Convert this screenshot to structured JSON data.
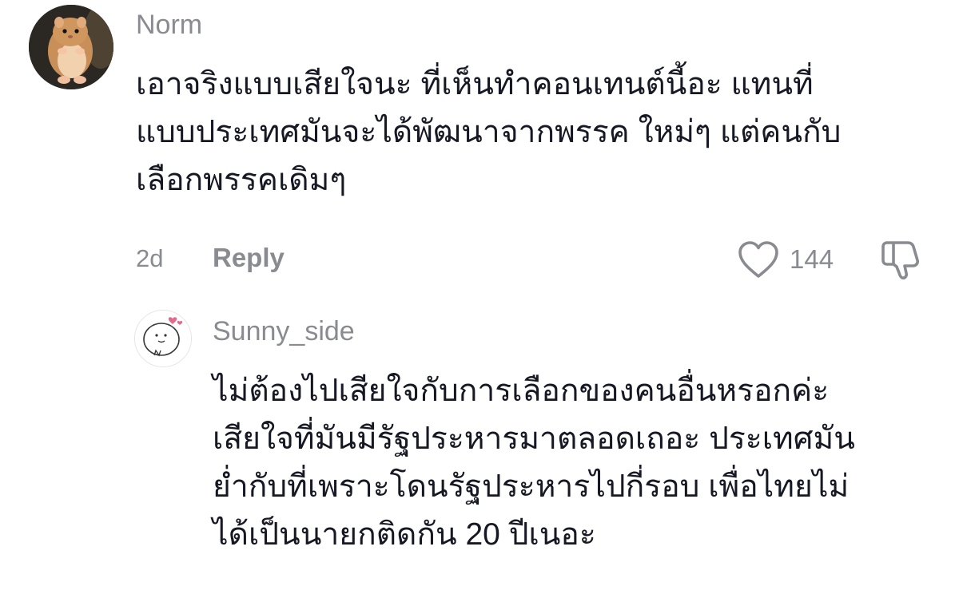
{
  "comments": [
    {
      "username": "Norm",
      "text_lines": [
        "เอาจริงแบบเสียใจนะ ที่เห็นทำคอนเทนต์นี้อะ แทนที่",
        "แบบประเทศมันจะได้พัฒนาจากพรรค ใหม่ๆ แต่คนกับ",
        "เลือกพรรคเดิมๆ"
      ],
      "age": "2d",
      "reply_label": "Reply",
      "like_count": "144",
      "avatar": "hamster-avatar"
    },
    {
      "username": "Sunny_side",
      "text_lines": [
        "ไม่ต้องไปเสียใจกับการเลือกของคนอื่นหรอกค่ะ",
        "เสียใจที่มันมีรัฐประหารมาตลอดเถอะ ประเทศมัน",
        "ย่ำกับที่เพราะโดนรัฐประหารไปกี่รอบ เพื่อไทยไม่",
        "ได้เป็นนายกติดกัน 20 ปีเนอะ"
      ],
      "avatar": "doodle-face-avatar"
    }
  ]
}
